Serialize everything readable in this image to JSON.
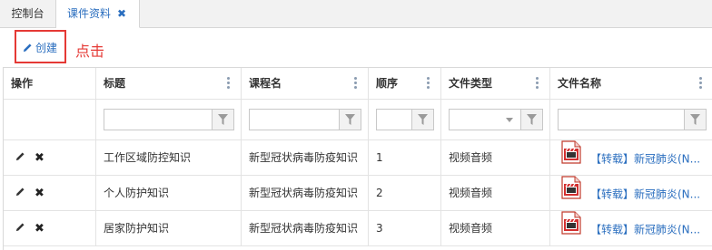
{
  "tabs": [
    {
      "label": "控制台"
    },
    {
      "label": "课件资料",
      "close": "✖"
    }
  ],
  "toolbar": {
    "create_label": "创建"
  },
  "annotation": {
    "text": "点击"
  },
  "grid": {
    "columns": [
      {
        "label": "操作"
      },
      {
        "label": "标题"
      },
      {
        "label": "课程名"
      },
      {
        "label": "顺序"
      },
      {
        "label": "文件类型"
      },
      {
        "label": "文件名称"
      }
    ],
    "rows": [
      {
        "title": "工作区域防控知识",
        "course": "新型冠状病毒防疫知识",
        "order": "1",
        "type": "视频音频",
        "file": "【转载】新冠肺炎(N..."
      },
      {
        "title": "个人防护知识",
        "course": "新型冠状病毒防疫知识",
        "order": "2",
        "type": "视频音频",
        "file": "【转载】新冠肺炎(N..."
      },
      {
        "title": "居家防护知识",
        "course": "新型冠状病毒防疫知识",
        "order": "3",
        "type": "视频音频",
        "file": "【转载】新冠肺炎(N..."
      }
    ]
  },
  "colors": {
    "accent": "#2a6ebf",
    "highlight": "#e53935"
  },
  "icons": {
    "edit": "pencil-icon",
    "delete": "close-icon",
    "filter": "filter-icon",
    "file": "video-file-icon",
    "column_menu": "kebab-icon"
  }
}
